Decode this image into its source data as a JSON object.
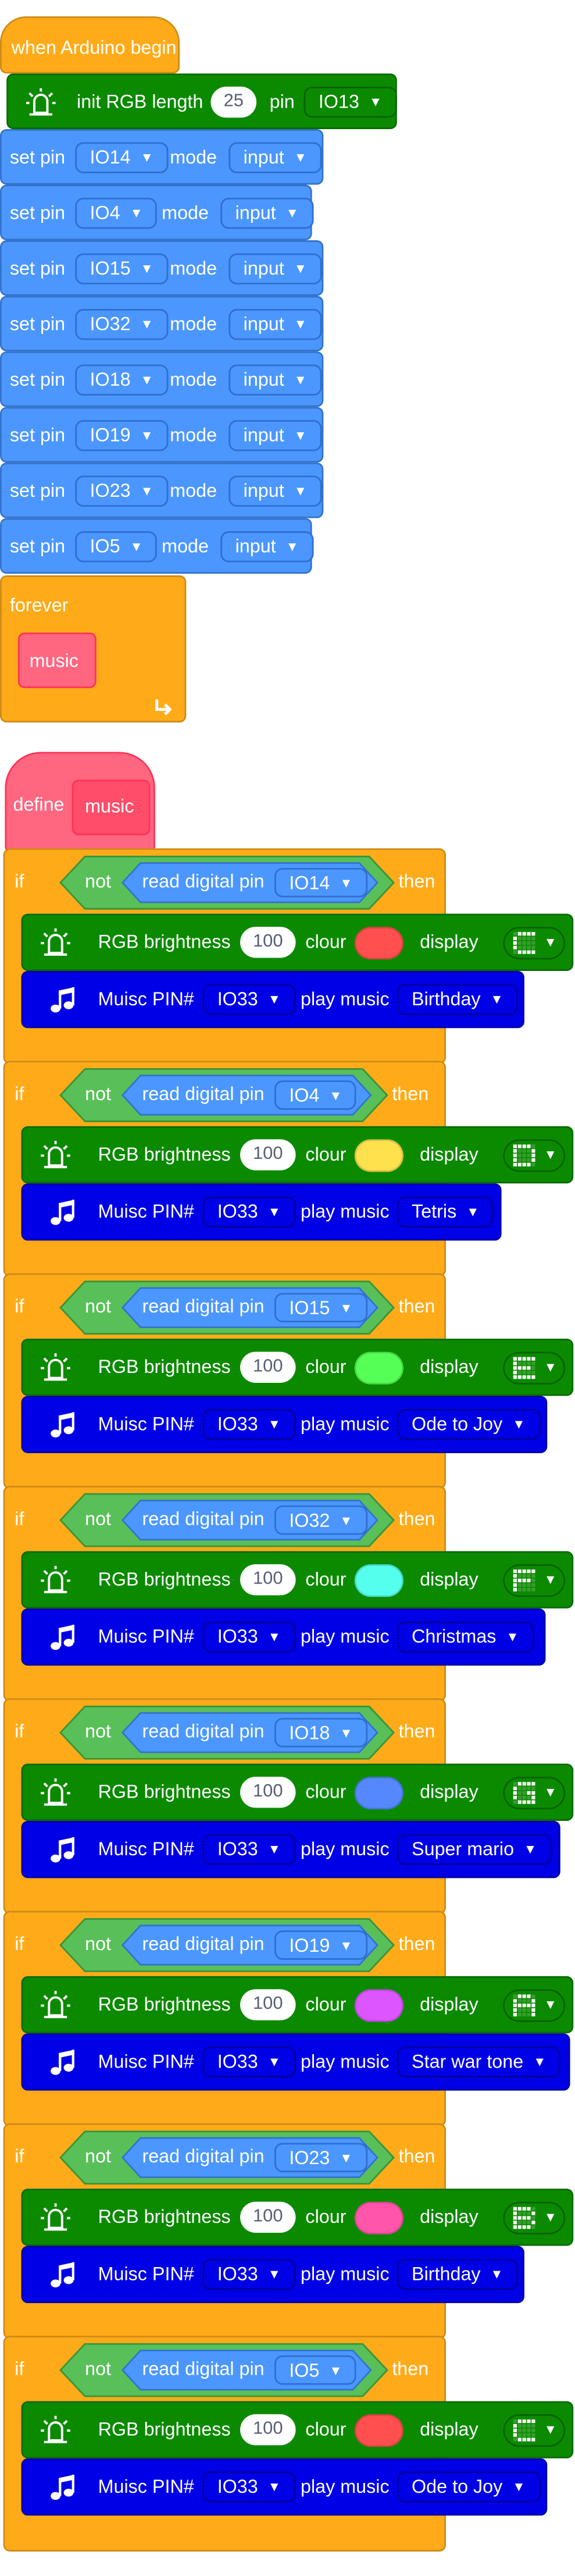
{
  "setup": {
    "hat_label": "when Arduino begin",
    "init_rgb": {
      "label": "init RGB length",
      "length": "25",
      "pin_label": "pin",
      "pin": "IO13"
    },
    "set_pins": [
      {
        "prefix": "set pin",
        "pin": "IO14",
        "mode_label": "mode",
        "mode": "input"
      },
      {
        "prefix": "set pin",
        "pin": "IO4",
        "mode_label": "mode",
        "mode": "input"
      },
      {
        "prefix": "set pin",
        "pin": "IO15",
        "mode_label": "mode",
        "mode": "input"
      },
      {
        "prefix": "set pin",
        "pin": "IO32",
        "mode_label": "mode",
        "mode": "input"
      },
      {
        "prefix": "set pin",
        "pin": "IO18",
        "mode_label": "mode",
        "mode": "input"
      },
      {
        "prefix": "set pin",
        "pin": "IO19",
        "mode_label": "mode",
        "mode": "input"
      },
      {
        "prefix": "set pin",
        "pin": "IO23",
        "mode_label": "mode",
        "mode": "input"
      },
      {
        "prefix": "set pin",
        "pin": "IO5",
        "mode_label": "mode",
        "mode": "input"
      }
    ],
    "forever_label": "forever",
    "call_label": "music",
    "loop_icon": "loop-arrow-icon"
  },
  "define": {
    "label": "define",
    "name": "music"
  },
  "labels": {
    "if": "if",
    "not": "not",
    "read": "read digital pin",
    "then": "then",
    "rgb": "RGB brightness",
    "clour": "clour",
    "display": "display",
    "muisc": "Muisc PIN#",
    "play": "play music"
  },
  "icons": {
    "rgb": "rgb-led-icon",
    "music": "music-note-icon",
    "dropdown": "caret-down-icon"
  },
  "if_blocks": [
    {
      "pin": "IO14",
      "brightness": "100",
      "color": "#ff4f4f",
      "music_pin": "IO33",
      "song": "Birthday",
      "pattern": "c"
    },
    {
      "pin": "IO4",
      "brightness": "100",
      "color": "#ffe14d",
      "music_pin": "IO33",
      "song": "Tetris",
      "pattern": "d"
    },
    {
      "pin": "IO15",
      "brightness": "100",
      "color": "#55ff55",
      "music_pin": "IO33",
      "song": "Ode to Joy",
      "pattern": "e"
    },
    {
      "pin": "IO32",
      "brightness": "100",
      "color": "#55ffee",
      "music_pin": "IO33",
      "song": "Christmas",
      "pattern": "f"
    },
    {
      "pin": "IO18",
      "brightness": "100",
      "color": "#5588ff",
      "music_pin": "IO33",
      "song": "Super mario",
      "pattern": "g"
    },
    {
      "pin": "IO19",
      "brightness": "100",
      "color": "#dd55ff",
      "music_pin": "IO33",
      "song": "Star war tone",
      "pattern": "a"
    },
    {
      "pin": "IO23",
      "brightness": "100",
      "color": "#ff55aa",
      "music_pin": "IO33",
      "song": "Birthday",
      "pattern": "b"
    },
    {
      "pin": "IO5",
      "brightness": "100",
      "color": "#ff4f4f",
      "music_pin": "IO33",
      "song": "Ode to Joy",
      "pattern": "c"
    }
  ]
}
